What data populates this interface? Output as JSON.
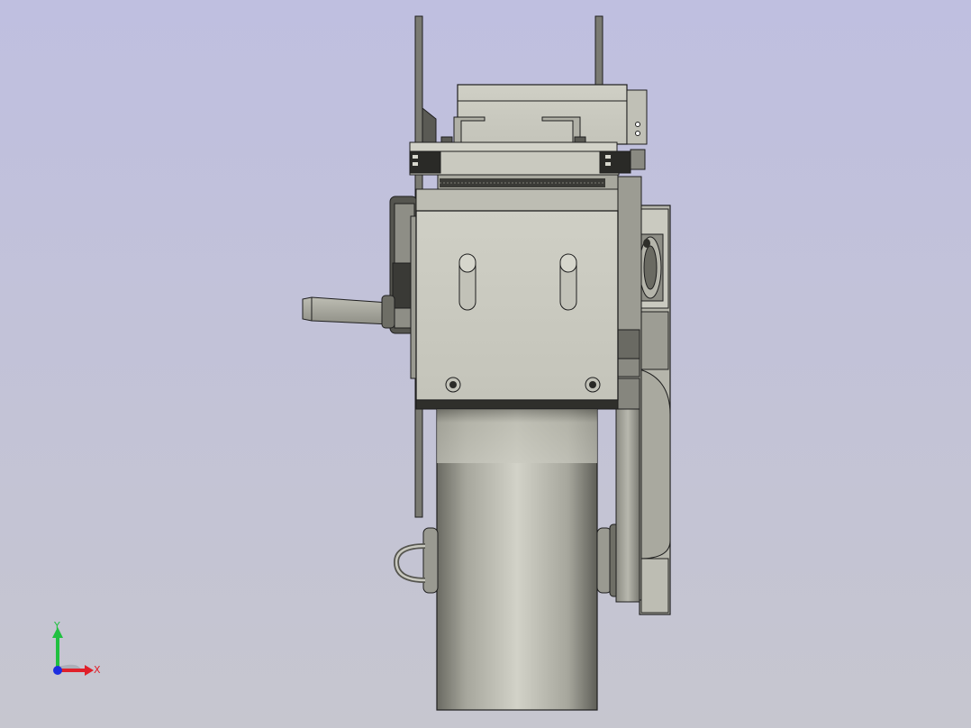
{
  "viewport": {
    "background_top": "#bfbfe0",
    "background_bottom": "#c6c6cf"
  },
  "model": {
    "body_color": "#c9c9bf",
    "body_dark": "#6e6e66",
    "wheel_light": "#cfcfc5",
    "wheel_dark": "#55554e",
    "edge_color": "#1e1e1e"
  },
  "triad": {
    "x_label": "X",
    "y_label": "Y",
    "x_color": "#e0202a",
    "y_color": "#20c040",
    "z_color": "#1c2ee0"
  }
}
